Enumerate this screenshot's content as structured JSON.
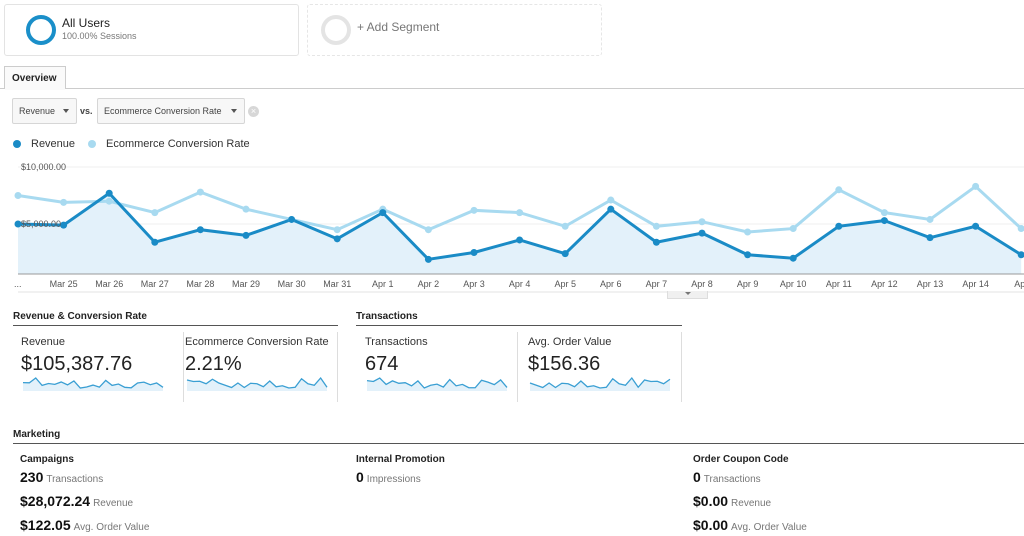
{
  "segments": {
    "active": {
      "title": "All Users",
      "subtitle": "100.00% Sessions"
    },
    "add_label": "+ Add Segment"
  },
  "tabs": [
    {
      "label": "Overview"
    }
  ],
  "controls": {
    "metric1": "Revenue",
    "vs_label": "vs.",
    "metric2": "Ecommerce Conversion Rate"
  },
  "colors": {
    "revenue": "#1a8bc6",
    "conversion": "#a8daf0",
    "area": "#e3f1fa"
  },
  "chart_data": {
    "type": "line",
    "series": [
      {
        "name": "Revenue",
        "values": [
          5000,
          4900,
          7700,
          3400,
          4500,
          4000,
          5400,
          3700,
          6000,
          1900,
          2500,
          3600,
          2400,
          6300,
          3400,
          4200,
          2300,
          2000,
          4800,
          5300,
          3800,
          4800,
          2300
        ]
      },
      {
        "name": "Ecommerce Conversion Rate",
        "values": [
          7500,
          6900,
          7000,
          6000,
          7800,
          6300,
          5400,
          4500,
          6300,
          4500,
          6200,
          6000,
          4800,
          7100,
          4800,
          5200,
          4300,
          4600,
          8000,
          6000,
          5400,
          8300,
          4600
        ]
      }
    ],
    "x": [
      "...",
      "Mar 25",
      "Mar 26",
      "Mar 27",
      "Mar 28",
      "Mar 29",
      "Mar 30",
      "Mar 31",
      "Apr 1",
      "Apr 2",
      "Apr 3",
      "Apr 4",
      "Apr 5",
      "Apr 6",
      "Apr 7",
      "Apr 8",
      "Apr 9",
      "Apr 10",
      "Apr 11",
      "Apr 12",
      "Apr 13",
      "Apr 14",
      "Apr"
    ],
    "y_ticks": [
      "$10,000.00",
      "$5,000.00"
    ],
    "ylim": [
      0,
      10000
    ],
    "grid": true,
    "legend": "top-left",
    "title": "",
    "xlabel": "",
    "ylabel": ""
  },
  "sections": {
    "rev_conv": {
      "title": "Revenue & Conversion Rate",
      "cards": [
        {
          "label": "Revenue",
          "value": "$105,387.76"
        },
        {
          "label": "Ecommerce Conversion Rate",
          "value": "2.21%"
        }
      ]
    },
    "transactions": {
      "title": "Transactions",
      "cards": [
        {
          "label": "Transactions",
          "value": "674"
        },
        {
          "label": "Avg. Order Value",
          "value": "$156.36"
        }
      ]
    }
  },
  "marketing": {
    "title": "Marketing",
    "groups": [
      {
        "title": "Campaigns",
        "rows": [
          {
            "value": "230",
            "label": "Transactions"
          },
          {
            "value": "$28,072.24",
            "label": "Revenue"
          },
          {
            "value": "$122.05",
            "label": "Avg. Order Value"
          }
        ]
      },
      {
        "title": "Internal Promotion",
        "rows": [
          {
            "value": "0",
            "label": "Impressions"
          }
        ]
      },
      {
        "title": "Order Coupon Code",
        "rows": [
          {
            "value": "0",
            "label": "Transactions"
          },
          {
            "value": "$0.00",
            "label": "Revenue"
          },
          {
            "value": "$0.00",
            "label": "Avg. Order Value"
          }
        ]
      }
    ]
  }
}
